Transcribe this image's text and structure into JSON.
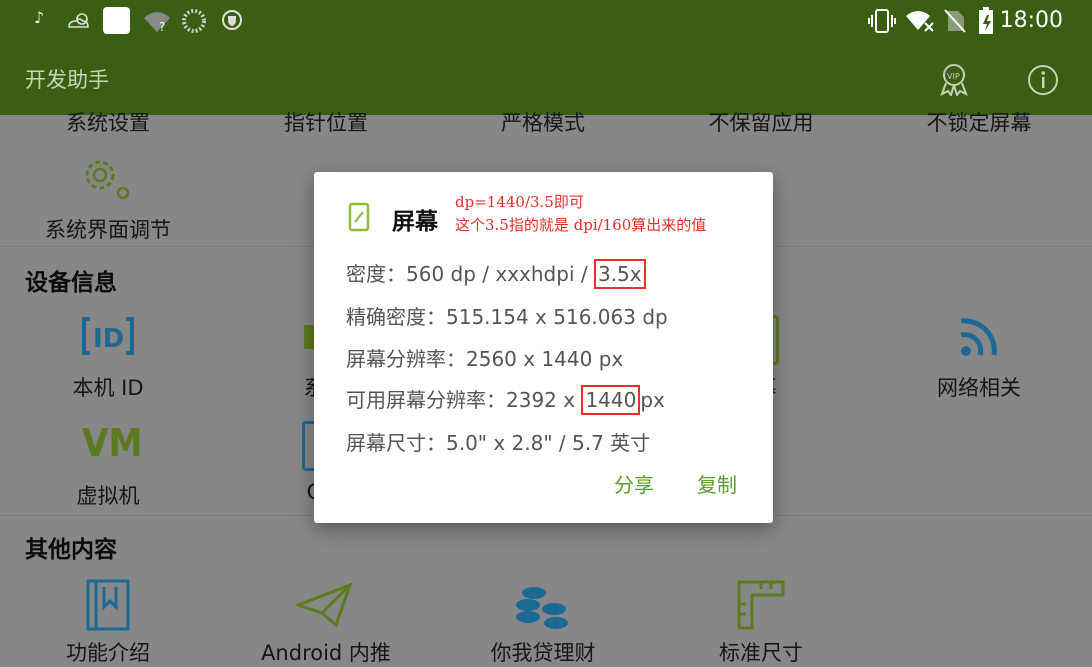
{
  "status_bar": {
    "time": "18:00",
    "icons": [
      "tiktok-icon",
      "weather-icon",
      "app-square-icon",
      "wifi-question-icon",
      "loading-circle-icon",
      "vpn-shield-icon",
      "vibrate-icon",
      "wifi-off-icon",
      "no-sim-icon",
      "battery-charging-icon"
    ]
  },
  "appbar": {
    "title": "开发助手",
    "icons": [
      "vip-badge-icon",
      "info-icon"
    ]
  },
  "top_row": [
    "系统设置",
    "指针位置",
    "严格模式",
    "不保留应用",
    "不锁定屏幕"
  ],
  "system_ui": {
    "label": "系统界面调节",
    "icon": "gear-icon"
  },
  "device_section": {
    "title": "设备信息",
    "items": [
      {
        "label": "本机 ID",
        "icon": "id-icon"
      },
      {
        "label": "系",
        "icon": "system-icon"
      },
      {
        "label": "幕",
        "icon": "screen-icon"
      },
      {
        "label": "网络相关",
        "icon": "wifi-signal-icon"
      },
      {
        "label": "虚拟机",
        "icon": "vm-icon"
      },
      {
        "label": "C",
        "icon": "cpu-icon"
      }
    ]
  },
  "other_section": {
    "title": "其他内容",
    "items": [
      {
        "label": "功能介绍",
        "icon": "book-icon"
      },
      {
        "label": "Android 内推",
        "icon": "paper-plane-icon"
      },
      {
        "label": "你我贷理财",
        "icon": "coins-icon"
      },
      {
        "label": "标准尺寸",
        "icon": "ruler-icon"
      }
    ]
  },
  "dialog": {
    "title": "屏幕",
    "annotation_line1": "dp=1440/3.5即可",
    "annotation_line2": "这个3.5指的就是 dpi/160算出来的值",
    "density_prefix": "密度：560 dp / xxxhdpi / ",
    "density_highlight": "3.5x",
    "precise_density": "精确密度：515.154 x 516.063 dp",
    "resolution": "屏幕分辨率：2560 x 1440 px",
    "usable_prefix": "可用屏幕分辨率：2392 x ",
    "usable_highlight": "1440",
    "usable_suffix": "px",
    "size": "屏幕尺寸：5.0\" x 2.8\" / 5.7 英寸",
    "share_label": "分享",
    "copy_label": "复制"
  },
  "colors": {
    "appbar": "#3a5f13",
    "accent": "#5c9e2c",
    "highlight": "#e3332f",
    "icon_blue": "#1c6a94",
    "icon_green": "#5c7a1e"
  }
}
